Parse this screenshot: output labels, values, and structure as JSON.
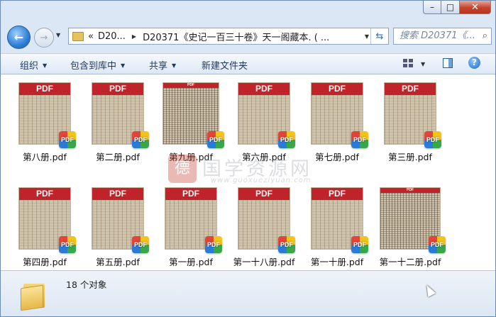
{
  "window": {
    "controls": {
      "minimize": "–",
      "maximize": "□",
      "close": "✕"
    }
  },
  "nav": {
    "recent_arrow": "▼",
    "breadcrumb": [
      "«",
      "D20...",
      "D20371《史记一百三十卷》天一阁藏本. ( ..."
    ],
    "search_placeholder": "搜索 D20371《...",
    "search_icon": "🔍"
  },
  "toolbar": {
    "organize": "组织",
    "include_library": "包含到库中",
    "share": "共享",
    "new_folder": "新建文件夹"
  },
  "files": [
    {
      "name": "第八册.pdf",
      "banner": "PDF",
      "badge": "PDF"
    },
    {
      "name": "第二册.pdf",
      "banner": "PDF",
      "badge": "PDF"
    },
    {
      "name": "第九册.pdf",
      "banner": "PDF",
      "badge": "PDF"
    },
    {
      "name": "第六册.pdf",
      "banner": "PDF",
      "badge": "PDF"
    },
    {
      "name": "第七册.pdf",
      "banner": "PDF",
      "badge": "PDF"
    },
    {
      "name": "第三册.pdf",
      "banner": "PDF",
      "badge": "PDF"
    },
    {
      "name": "第四册.pdf",
      "banner": "PDF",
      "badge": "PDF"
    },
    {
      "name": "第五册.pdf",
      "banner": "PDF",
      "badge": "PDF"
    },
    {
      "name": "第一册.pdf",
      "banner": "PDF",
      "badge": "PDF"
    },
    {
      "name": "第一十八册.pdf",
      "banner": "PDF",
      "badge": "PDF"
    },
    {
      "name": "第一十册.pdf",
      "banner": "PDF",
      "badge": "PDF"
    },
    {
      "name": "第一十二册.pdf",
      "banner": "PDF",
      "badge": "PDF"
    }
  ],
  "watermark": {
    "logo": "德",
    "title": "国学资源网",
    "url": "www.guoxueziyuan.com"
  },
  "status": {
    "count": "18 个对象"
  },
  "colors": {
    "banner": "#c0232a",
    "window": "#dbe7f5"
  }
}
